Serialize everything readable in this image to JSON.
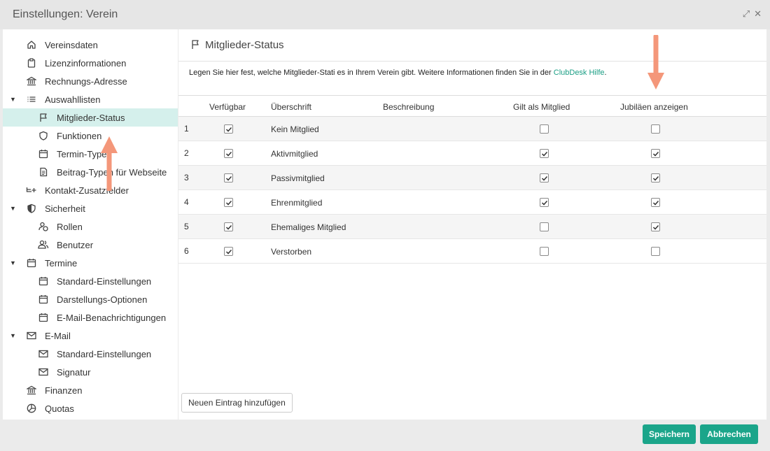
{
  "window": {
    "title": "Einstellungen: Verein"
  },
  "sidebar": {
    "items": [
      {
        "label": "Vereinsdaten",
        "icon": "home-icon"
      },
      {
        "label": "Lizenzinformationen",
        "icon": "clipboard-icon"
      },
      {
        "label": "Rechnungs-Adresse",
        "icon": "bank-icon"
      },
      {
        "label": "Auswahllisten",
        "icon": "list-icon"
      },
      {
        "label": "Mitglieder-Status",
        "icon": "flag-icon"
      },
      {
        "label": "Funktionen",
        "icon": "shield-icon"
      },
      {
        "label": "Termin-Typen",
        "icon": "calendar-icon"
      },
      {
        "label": "Beitrag-Typen für Webseite",
        "icon": "document-icon"
      },
      {
        "label": "Kontakt-Zusatzfelder",
        "icon": "add-field-icon"
      },
      {
        "label": "Sicherheit",
        "icon": "shield-half-icon"
      },
      {
        "label": "Rollen",
        "icon": "user-lock-icon"
      },
      {
        "label": "Benutzer",
        "icon": "users-icon"
      },
      {
        "label": "Termine",
        "icon": "calendar-icon"
      },
      {
        "label": "Standard-Einstellungen",
        "icon": "calendar-icon"
      },
      {
        "label": "Darstellungs-Optionen",
        "icon": "calendar-icon"
      },
      {
        "label": "E-Mail-Benachrichtigungen",
        "icon": "calendar-icon"
      },
      {
        "label": "E-Mail",
        "icon": "mail-icon"
      },
      {
        "label": "Standard-Einstellungen",
        "icon": "mail-icon"
      },
      {
        "label": "Signatur",
        "icon": "mail-icon"
      },
      {
        "label": "Finanzen",
        "icon": "bank-icon"
      },
      {
        "label": "Quotas",
        "icon": "pie-chart-icon"
      }
    ]
  },
  "panel": {
    "title": "Mitglieder-Status",
    "intro_text": "Legen Sie hier fest, welche Mitglieder-Stati es in Ihrem Verein gibt. Weitere Informationen finden Sie in der ",
    "intro_link": "ClubDesk Hilfe",
    "intro_end": "."
  },
  "table": {
    "columns": [
      "Verfügbar",
      "Überschrift",
      "Beschreibung",
      "Gilt als Mitglied",
      "Jubiläen anzeigen"
    ],
    "rows": [
      {
        "num": "1",
        "available": true,
        "title": "Kein Mitglied",
        "description": "",
        "is_member": false,
        "jubilee": false
      },
      {
        "num": "2",
        "available": true,
        "title": "Aktivmitglied",
        "description": "",
        "is_member": true,
        "jubilee": true
      },
      {
        "num": "3",
        "available": true,
        "title": "Passivmitglied",
        "description": "",
        "is_member": true,
        "jubilee": true
      },
      {
        "num": "4",
        "available": true,
        "title": "Ehrenmitglied",
        "description": "",
        "is_member": true,
        "jubilee": true
      },
      {
        "num": "5",
        "available": true,
        "title": "Ehemaliges Mitglied",
        "description": "",
        "is_member": false,
        "jubilee": true
      },
      {
        "num": "6",
        "available": true,
        "title": "Verstorben",
        "description": "",
        "is_member": false,
        "jubilee": false
      }
    ]
  },
  "buttons": {
    "add": "Neuen Eintrag hinzufügen",
    "save": "Speichern",
    "cancel": "Abbrechen"
  },
  "colors": {
    "accent": "#1ba58a",
    "link": "#1a9e84",
    "active_item": "#d5f0ec",
    "arrow": "#f4977a"
  }
}
